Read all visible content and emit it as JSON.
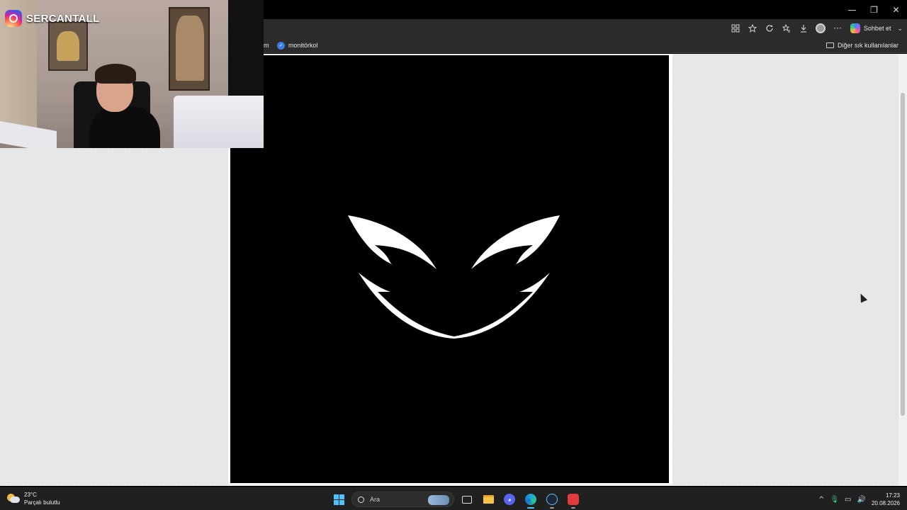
{
  "browser": {
    "window_controls": {
      "minimize": "—",
      "restore": "❐",
      "close": "✕"
    },
    "toolbar": {
      "icons": [
        "app-grid-icon",
        "star-icon",
        "refresh-icon",
        "favorites-icon",
        "download-icon"
      ],
      "more_label": "···",
      "copilot_label": "Sohbet et",
      "copilot_chevron": "⌄"
    },
    "bookmarks": {
      "partial_item_label": "m",
      "item_label": "monitörkol",
      "other_folder_label": "Diğer sık kullanılanlar"
    }
  },
  "webcam": {
    "instagram_handle": "SERCANTALL"
  },
  "taskbar": {
    "weather": {
      "temperature": "23°C",
      "condition": "Parçalı bulutlu"
    },
    "search_placeholder": "Ara",
    "tray": {
      "chevron": "^",
      "mic": "🎙",
      "display": "▭",
      "volume": "🔊"
    },
    "clock": {
      "time": "17:23",
      "date": "20.08.2026"
    }
  },
  "colors": {
    "page_background": "#e9e9e9",
    "logo_background": "#000000",
    "logo_foreground": "#ffffff",
    "taskbar": "#202020",
    "toolbar": "#2b2b2b"
  }
}
